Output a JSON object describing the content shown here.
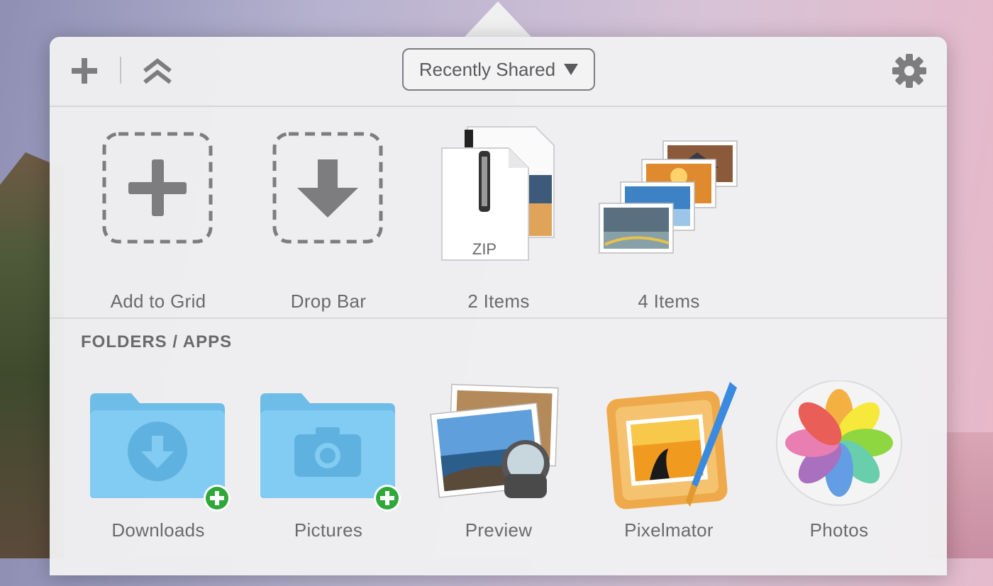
{
  "toolbar": {
    "add_icon": "plus-icon",
    "collapse_icon": "double-chevron-up-icon",
    "dropdown_label": "Recently Shared",
    "settings_icon": "gear-icon"
  },
  "recent": {
    "items": [
      {
        "label": "Add to Grid",
        "icon": "dashed-plus-icon"
      },
      {
        "label": "Drop Bar",
        "icon": "dashed-download-icon"
      },
      {
        "label": "2 Items",
        "icon": "zip-file-icon",
        "badge": "ZIP"
      },
      {
        "label": "4 Items",
        "icon": "photo-stack-icon"
      }
    ]
  },
  "folders": {
    "title": "FOLDERS / APPS",
    "items": [
      {
        "label": "Downloads",
        "icon": "downloads-folder-icon"
      },
      {
        "label": "Pictures",
        "icon": "pictures-folder-icon"
      },
      {
        "label": "Preview",
        "icon": "preview-app-icon"
      },
      {
        "label": "Pixelmator",
        "icon": "pixelmator-app-icon"
      },
      {
        "label": "Photos",
        "icon": "photos-app-icon"
      }
    ]
  },
  "colors": {
    "folder_blue": "#7cc6ef",
    "add_badge_green": "#2fa83a",
    "icon_gray": "#7d7d80"
  }
}
